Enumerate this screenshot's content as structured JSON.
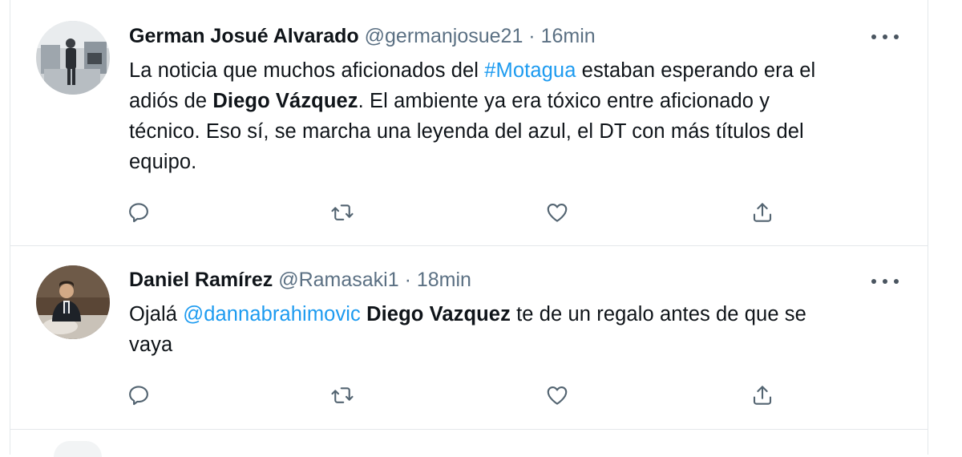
{
  "tweets": [
    {
      "name": "German Josué Alvarado",
      "handle": "@germanjosue21",
      "separator": " · ",
      "time": "16min",
      "body": [
        {
          "text": "La noticia que muchos aficionados del ",
          "style": "plain"
        },
        {
          "text": "#Motagua",
          "style": "link"
        },
        {
          "text": " estaban esperando era el",
          "style": "plain"
        },
        {
          "text": "\n",
          "style": "br"
        },
        {
          "text": "adiós de ",
          "style": "plain"
        },
        {
          "text": "Diego Vázquez",
          "style": "bold"
        },
        {
          "text": ". El ambiente ya era tóxico entre aficionado y",
          "style": "plain"
        },
        {
          "text": "\n",
          "style": "br"
        },
        {
          "text": "técnico. Eso sí, se marcha una leyenda del azul, el DT con más títulos del",
          "style": "plain"
        },
        {
          "text": "\n",
          "style": "br"
        },
        {
          "text": "equipo.",
          "style": "plain"
        }
      ]
    },
    {
      "name": "Daniel Ramírez",
      "handle": "@Ramasaki1",
      "separator": " · ",
      "time": "18min",
      "body": [
        {
          "text": "Ojalá ",
          "style": "plain"
        },
        {
          "text": "@dannabrahimovic",
          "style": "link"
        },
        {
          "text": " ",
          "style": "plain"
        },
        {
          "text": "Diego Vazquez",
          "style": "bold"
        },
        {
          "text": " te de un regalo antes de que se",
          "style": "plain"
        },
        {
          "text": "\n",
          "style": "br"
        },
        {
          "text": "vaya",
          "style": "plain"
        }
      ]
    }
  ],
  "icons": {
    "reply": "reply-icon",
    "retweet": "retweet-icon",
    "like": "heart-icon",
    "share": "share-icon",
    "more": "more-options-icon"
  },
  "colors": {
    "text": "#0f1419",
    "secondary": "#5b7083",
    "link": "#1d9bf0",
    "divider": "#e4e8eb",
    "icon": "#536471"
  }
}
